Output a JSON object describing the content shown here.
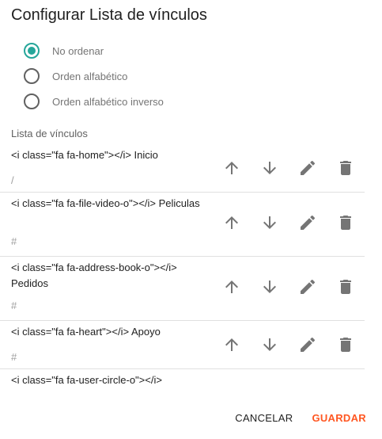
{
  "dialog": {
    "title": "Configurar Lista de vínculos"
  },
  "sort_options": [
    {
      "label": "No ordenar",
      "checked": true
    },
    {
      "label": "Orden alfabético",
      "checked": false
    },
    {
      "label": "Orden alfabético inverso",
      "checked": false
    }
  ],
  "links_section": {
    "label": "Lista de vínculos"
  },
  "links": [
    {
      "text": "<i class=\"fa fa-home\"></i> Inicio",
      "url": "/"
    },
    {
      "text": "<i class=\"fa fa-file-video-o\"></i> Peliculas",
      "url": "#"
    },
    {
      "text": "<i class=\"fa fa-address-book-o\"></i> Pedidos",
      "url": "#"
    },
    {
      "text": "<i class=\"fa fa-heart\"></i> Apoyo",
      "url": "#"
    },
    {
      "text": "<i class=\"fa fa-user-circle-o\"></i>",
      "url": ""
    }
  ],
  "icons": {
    "move_up": "arrow-up-icon",
    "move_down": "arrow-down-icon",
    "edit": "pencil-icon",
    "delete": "trash-icon"
  },
  "footer": {
    "cancel_label": "CANCELAR",
    "save_label": "GUARDAR"
  },
  "colors": {
    "accent": "#26a69a",
    "save": "#ff5722"
  }
}
